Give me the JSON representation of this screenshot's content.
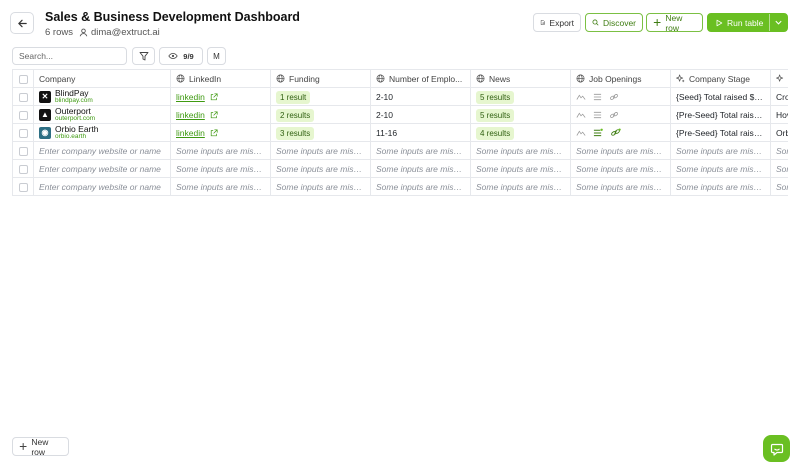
{
  "header": {
    "title": "Sales & Business Development Dashboard",
    "row_count": "6 rows",
    "user_email": "dima@extruct.ai"
  },
  "actions": {
    "export": "Export",
    "discover": "Discover",
    "new_row": "New row",
    "run_table": "Run table"
  },
  "toolbar": {
    "search_placeholder": "Search...",
    "visible_columns": "9/9",
    "m_label": "M"
  },
  "columns": [
    {
      "label": "Company",
      "icon": "none"
    },
    {
      "label": "LinkedIn",
      "icon": "globe-icon"
    },
    {
      "label": "Funding",
      "icon": "globe-icon"
    },
    {
      "label": "Number of Emplo...",
      "icon": "globe-icon"
    },
    {
      "label": "News",
      "icon": "globe-icon"
    },
    {
      "label": "Job Openings",
      "icon": "globe-icon"
    },
    {
      "label": "Company Stage",
      "icon": "sparkle-icon"
    }
  ],
  "rows": [
    {
      "company": "BlindPay",
      "domain": "blindpay.com",
      "logo_color": "#111111",
      "logo_glyph": "✕",
      "linkedin": "linkedin",
      "funding": "1 result",
      "employees": "2-10",
      "news": "5 results",
      "stage": "{Seed} Total raised $5...",
      "extra": "Cro"
    },
    {
      "company": "Outerport",
      "domain": "outerport.com",
      "logo_color": "#111111",
      "logo_glyph": "▲",
      "linkedin": "linkedin",
      "funding": "2 results",
      "employees": "2-10",
      "news": "5 results",
      "stage": "{Pre-Seed} Total raise...",
      "extra": "Hov"
    },
    {
      "company": "Orbio Earth",
      "domain": "orbio.earth",
      "logo_color": "#2d6f84",
      "logo_glyph": "◉",
      "linkedin": "linkedin",
      "funding": "3 results",
      "employees": "11-16",
      "news": "4 results",
      "stage": "{Pre-Seed} Total raise...",
      "extra": "Orb"
    }
  ],
  "empty_rows": {
    "company_placeholder": "Enter company website or name",
    "input_placeholder": "Some inputs are missin..."
  },
  "footer": {
    "new_row": "New row"
  },
  "colors": {
    "accent": "#6abf22",
    "link_green": "#3f9a12",
    "pill_bg": "#e6f6cf"
  }
}
